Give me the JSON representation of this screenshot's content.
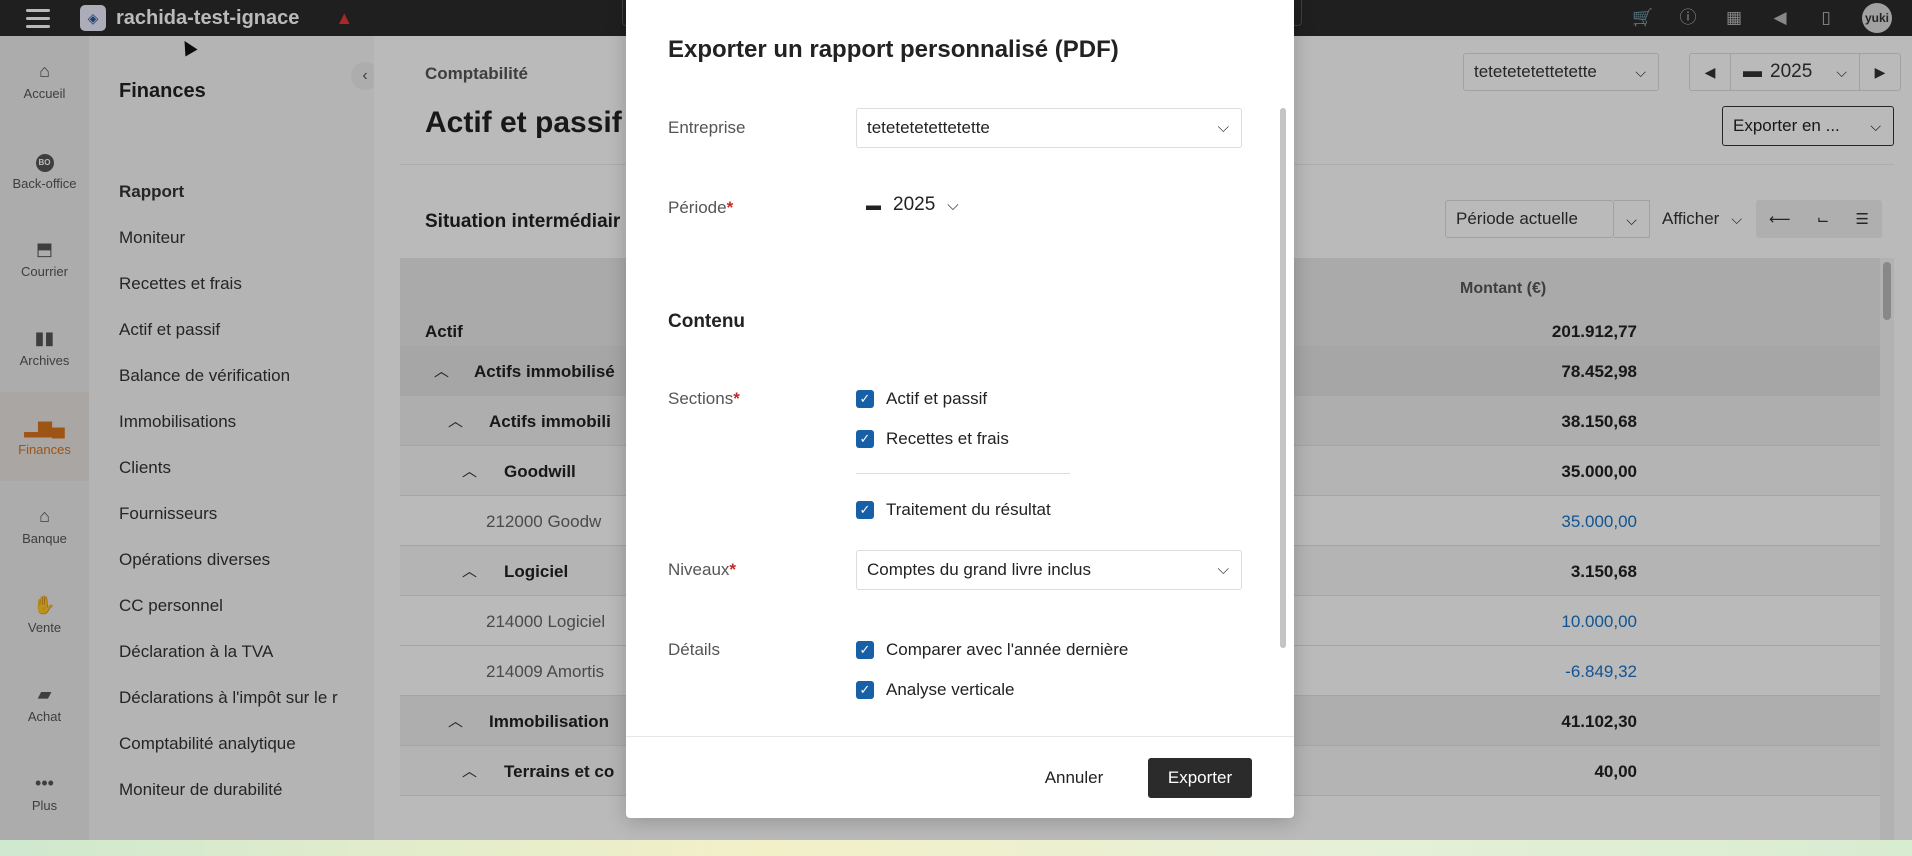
{
  "topbar": {
    "company": "rachida-test-ignace",
    "avatar": "yuki",
    "icons": [
      "cart-icon",
      "info-icon",
      "store-icon",
      "megaphone-icon",
      "bookmark-icon"
    ]
  },
  "rail": [
    {
      "label": "Accueil",
      "icon": "home-icon",
      "glyph": "⌂"
    },
    {
      "label": "Back-office",
      "icon": "backoffice-icon",
      "glyph": "BO"
    },
    {
      "label": "Courrier",
      "icon": "inbox-icon",
      "glyph": "⬒"
    },
    {
      "label": "Archives",
      "icon": "archive-icon",
      "glyph": "▮▮"
    },
    {
      "label": "Finances",
      "icon": "chart-icon",
      "glyph": "▂▆▄",
      "active": true
    },
    {
      "label": "Banque",
      "icon": "bank-icon",
      "glyph": "🏛"
    },
    {
      "label": "Vente",
      "icon": "handshake-icon",
      "glyph": "🤝"
    },
    {
      "label": "Achat",
      "icon": "truck-icon",
      "glyph": "🚚"
    },
    {
      "label": "Plus",
      "icon": "more-icon",
      "glyph": "•••"
    }
  ],
  "submenu": {
    "title": "Finances",
    "section": "Rapport",
    "items": [
      "Moniteur",
      "Recettes et frais",
      "Actif et passif",
      "Balance de vérification",
      "Immobilisations",
      "Clients",
      "Fournisseurs",
      "Opérations diverses",
      "CC personnel",
      "Déclaration à la TVA",
      "Déclarations à l'impôt sur le r",
      "Comptabilité analytique",
      "Moniteur de durabilité"
    ]
  },
  "main": {
    "breadcrumb": "Comptabilité",
    "title": "Actif et passif",
    "entity": "tetetetetettetette",
    "year": "2025",
    "export_label": "Exporter en ...",
    "card_title": "Situation intermédiair",
    "period_label": "Période actuelle",
    "afficher_label": "Afficher",
    "table": {
      "col_amount": "Montant (€)",
      "root_label": "Actif",
      "root_amount": "201.912,77",
      "rows": [
        {
          "label": "Actifs immobilisé",
          "amount": "78.452,98",
          "level": 1
        },
        {
          "label": "Actifs immobili",
          "amount": "38.150,68",
          "level": 2
        },
        {
          "label": "Goodwill",
          "amount": "35.000,00",
          "level": 3
        },
        {
          "label": "212000 Goodw",
          "amount": "35.000,00",
          "level": 4
        },
        {
          "label": "Logiciel",
          "amount": "3.150,68",
          "level": 3
        },
        {
          "label": "214000 Logiciel",
          "amount": "10.000,00",
          "level": 4
        },
        {
          "label": "214009 Amortis",
          "amount": "-6.849,32",
          "level": 4
        },
        {
          "label": "Immobilisation",
          "amount": "41.102,30",
          "level": 2
        },
        {
          "label": "Terrains et co",
          "amount": "40,00",
          "level": 3
        }
      ]
    }
  },
  "modal": {
    "title": "Exporter un rapport personnalisé (PDF)",
    "entreprise_label": "Entreprise",
    "entreprise_value": "tetetetetettetette",
    "periode_label": "Période",
    "periode_value": "2025",
    "required_mark": "*",
    "contenu_heading": "Contenu",
    "sections_label": "Sections",
    "sections": [
      "Actif et passif",
      "Recettes et frais",
      "Traitement du résultat"
    ],
    "niveaux_label": "Niveaux",
    "niveaux_value": "Comptes du grand livre inclus",
    "details_label": "Détails",
    "details": [
      "Comparer avec l'année dernière",
      "Analyse verticale"
    ],
    "cancel_label": "Annuler",
    "export_label": "Exporter"
  }
}
